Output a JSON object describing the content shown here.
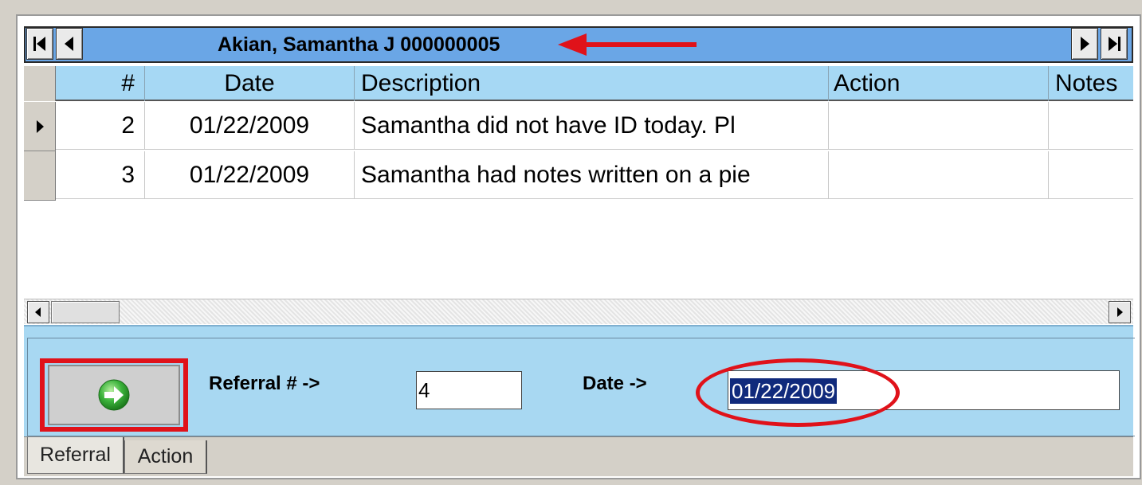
{
  "navigator": {
    "record_title": "Akian, Samantha J 000000005"
  },
  "grid": {
    "columns": [
      {
        "label": "#"
      },
      {
        "label": "Date"
      },
      {
        "label": "Description"
      },
      {
        "label": "Action"
      },
      {
        "label": "Notes"
      }
    ],
    "rows": [
      {
        "num": "2",
        "date": "01/22/2009",
        "description": "Samantha did not have ID today.  Pl",
        "action": "",
        "notes": ""
      },
      {
        "num": "3",
        "date": "01/22/2009",
        "description": "Samantha had notes written on a pie",
        "action": "",
        "notes": ""
      }
    ]
  },
  "form": {
    "referral_label": "Referral # ->",
    "referral_value": "4",
    "date_label": "Date ->",
    "date_value": "01/22/2009"
  },
  "tabs": [
    {
      "label": "Referral",
      "active": true
    },
    {
      "label": "Action",
      "active": false
    }
  ],
  "colors": {
    "navbar": "#6aa6e6",
    "header": "#a6d8f4",
    "panel": "#a8d8f2",
    "annotation": "#e0121a",
    "selection": "#102a7c"
  }
}
